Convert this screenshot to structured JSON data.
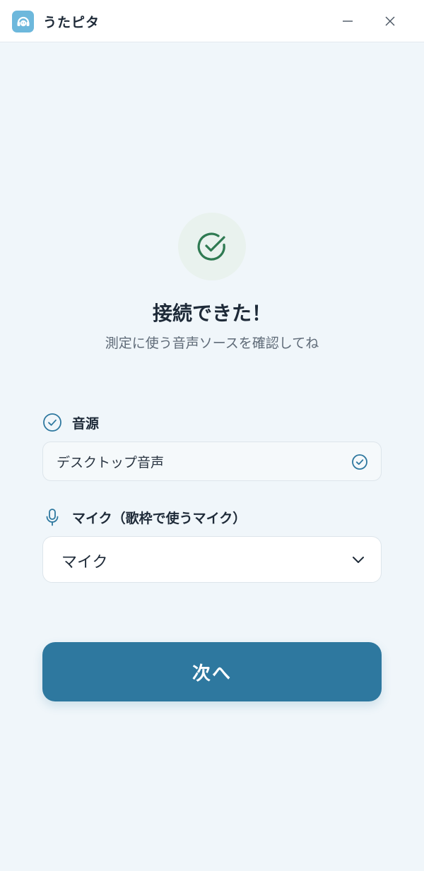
{
  "window": {
    "title": "うたピタ",
    "app_icon": "headphones-face-icon",
    "controls": [
      "minimize-icon",
      "close-icon"
    ]
  },
  "status": {
    "icon": "check-circle-icon",
    "heading": "接続できた！",
    "subheading": "測定に使う音声ソースを確認してね"
  },
  "source": {
    "label": "音源",
    "value": "デスクトップ音声"
  },
  "mic": {
    "label": "マイク（歌枠で使うマイク）",
    "value": "マイク"
  },
  "actions": {
    "next_label": "次へ"
  },
  "colors": {
    "accent": "#2e789f",
    "success": "#2f7a52",
    "background": "#f0f6fa"
  }
}
